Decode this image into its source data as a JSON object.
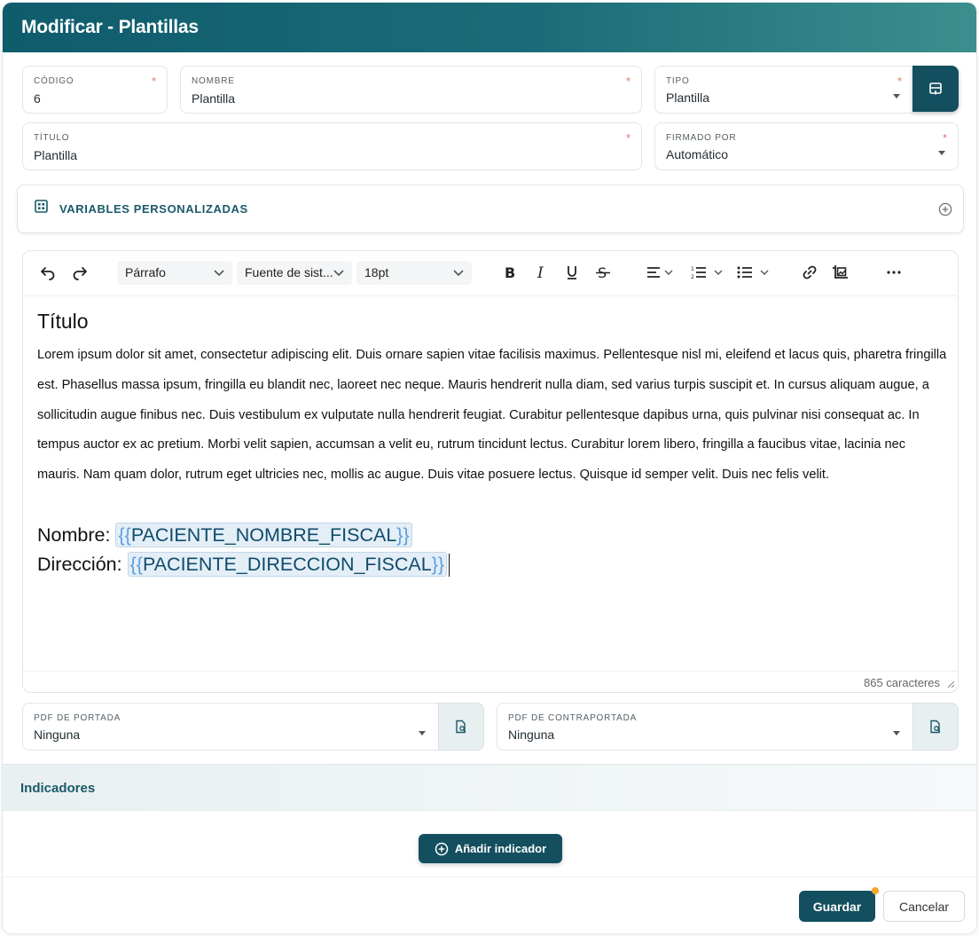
{
  "dialog": {
    "title": "Modificar - Plantillas"
  },
  "form": {
    "codigo": {
      "label": "Código",
      "value": "6",
      "required": "*"
    },
    "nombre": {
      "label": "Nombre",
      "value": "Plantilla",
      "required": "*"
    },
    "tipo": {
      "label": "Tipo",
      "value": "Plantilla",
      "required": "*"
    },
    "titulo": {
      "label": "Título",
      "value": "Plantilla",
      "required": "*"
    },
    "firmado_por": {
      "label": "Firmado por",
      "value": "Automático",
      "required": "*"
    }
  },
  "variables": {
    "title": "VARIABLES PERSONALIZADAS"
  },
  "editor": {
    "toolbar": {
      "block_format": "Párrafo",
      "font_family": "Fuente de sist...",
      "font_size": "18pt"
    },
    "content": {
      "heading": "Título",
      "paragraph": "Lorem ipsum dolor sit amet, consectetur adipiscing elit. Duis ornare sapien vitae facilisis maximus. Pellentesque nisl mi, eleifend et lacus quis, pharetra fringilla est. Phasellus massa ipsum, fringilla eu blandit nec, laoreet nec neque. Mauris hendrerit nulla diam, sed varius turpis suscipit et. In cursus aliquam augue, a sollicitudin augue finibus nec. Duis vestibulum ex vulputate nulla hendrerit feugiat. Curabitur pellentesque dapibus urna, quis pulvinar nisi consequat ac. In tempus auctor ex ac pretium. Morbi velit sapien, accumsan a velit eu, rutrum tincidunt lectus. Curabitur lorem libero, fringilla a faucibus vitae, lacinia nec mauris. Nam quam dolor, rutrum eget ultricies nec, mollis ac augue. Duis vitae posuere lectus. Quisque id semper velit. Duis nec felis velit.",
      "nombre_label": "Nombre:",
      "nombre_var": "PACIENTE_NOMBRE_FISCAL",
      "direccion_label": "Dirección:",
      "direccion_var": "PACIENTE_DIRECCION_FISCAL",
      "brace_open": "{{",
      "brace_close": "}}"
    },
    "char_count": "865 caracteres"
  },
  "pdfs": {
    "portada": {
      "label": "PDF de portada",
      "value": "Ninguna"
    },
    "contraportada": {
      "label": "PDF de contraportada",
      "value": "Ninguna"
    }
  },
  "indicators": {
    "title": "Indicadores",
    "add_label": "Añadir indicador"
  },
  "footer": {
    "save_label": "Guardar",
    "cancel_label": "Cancelar"
  },
  "colors": {
    "primary": "#134f5f",
    "header_start": "#0f5c6c",
    "header_end": "#3b8f8e",
    "required": "#e07a6a",
    "badge": "#f5a623"
  }
}
